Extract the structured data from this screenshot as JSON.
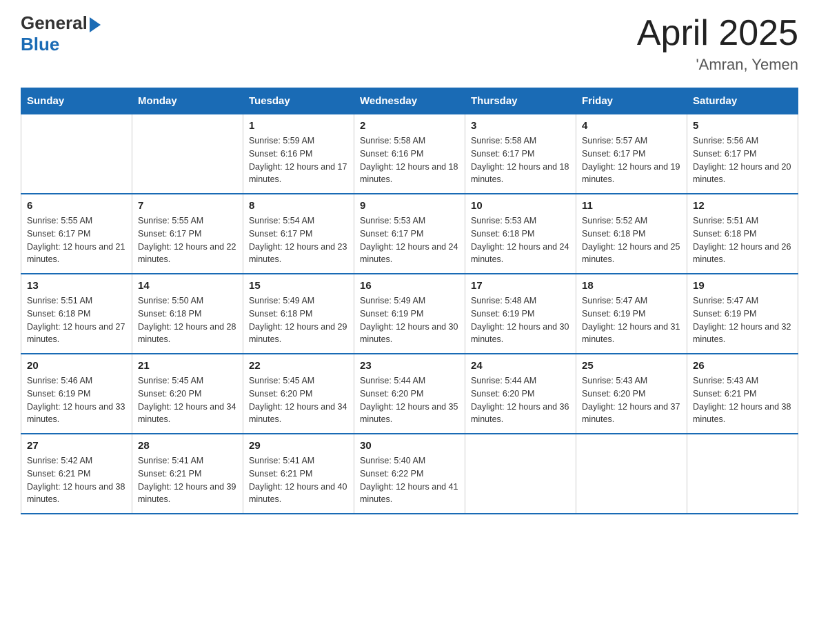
{
  "header": {
    "logo": {
      "text_general": "General",
      "text_blue": "Blue"
    },
    "month_title": "April 2025",
    "location": "'Amran, Yemen"
  },
  "weekdays": [
    "Sunday",
    "Monday",
    "Tuesday",
    "Wednesday",
    "Thursday",
    "Friday",
    "Saturday"
  ],
  "weeks": [
    [
      {
        "day": "",
        "sunrise": "",
        "sunset": "",
        "daylight": ""
      },
      {
        "day": "",
        "sunrise": "",
        "sunset": "",
        "daylight": ""
      },
      {
        "day": "1",
        "sunrise": "Sunrise: 5:59 AM",
        "sunset": "Sunset: 6:16 PM",
        "daylight": "Daylight: 12 hours and 17 minutes."
      },
      {
        "day": "2",
        "sunrise": "Sunrise: 5:58 AM",
        "sunset": "Sunset: 6:16 PM",
        "daylight": "Daylight: 12 hours and 18 minutes."
      },
      {
        "day": "3",
        "sunrise": "Sunrise: 5:58 AM",
        "sunset": "Sunset: 6:17 PM",
        "daylight": "Daylight: 12 hours and 18 minutes."
      },
      {
        "day": "4",
        "sunrise": "Sunrise: 5:57 AM",
        "sunset": "Sunset: 6:17 PM",
        "daylight": "Daylight: 12 hours and 19 minutes."
      },
      {
        "day": "5",
        "sunrise": "Sunrise: 5:56 AM",
        "sunset": "Sunset: 6:17 PM",
        "daylight": "Daylight: 12 hours and 20 minutes."
      }
    ],
    [
      {
        "day": "6",
        "sunrise": "Sunrise: 5:55 AM",
        "sunset": "Sunset: 6:17 PM",
        "daylight": "Daylight: 12 hours and 21 minutes."
      },
      {
        "day": "7",
        "sunrise": "Sunrise: 5:55 AM",
        "sunset": "Sunset: 6:17 PM",
        "daylight": "Daylight: 12 hours and 22 minutes."
      },
      {
        "day": "8",
        "sunrise": "Sunrise: 5:54 AM",
        "sunset": "Sunset: 6:17 PM",
        "daylight": "Daylight: 12 hours and 23 minutes."
      },
      {
        "day": "9",
        "sunrise": "Sunrise: 5:53 AM",
        "sunset": "Sunset: 6:17 PM",
        "daylight": "Daylight: 12 hours and 24 minutes."
      },
      {
        "day": "10",
        "sunrise": "Sunrise: 5:53 AM",
        "sunset": "Sunset: 6:18 PM",
        "daylight": "Daylight: 12 hours and 24 minutes."
      },
      {
        "day": "11",
        "sunrise": "Sunrise: 5:52 AM",
        "sunset": "Sunset: 6:18 PM",
        "daylight": "Daylight: 12 hours and 25 minutes."
      },
      {
        "day": "12",
        "sunrise": "Sunrise: 5:51 AM",
        "sunset": "Sunset: 6:18 PM",
        "daylight": "Daylight: 12 hours and 26 minutes."
      }
    ],
    [
      {
        "day": "13",
        "sunrise": "Sunrise: 5:51 AM",
        "sunset": "Sunset: 6:18 PM",
        "daylight": "Daylight: 12 hours and 27 minutes."
      },
      {
        "day": "14",
        "sunrise": "Sunrise: 5:50 AM",
        "sunset": "Sunset: 6:18 PM",
        "daylight": "Daylight: 12 hours and 28 minutes."
      },
      {
        "day": "15",
        "sunrise": "Sunrise: 5:49 AM",
        "sunset": "Sunset: 6:18 PM",
        "daylight": "Daylight: 12 hours and 29 minutes."
      },
      {
        "day": "16",
        "sunrise": "Sunrise: 5:49 AM",
        "sunset": "Sunset: 6:19 PM",
        "daylight": "Daylight: 12 hours and 30 minutes."
      },
      {
        "day": "17",
        "sunrise": "Sunrise: 5:48 AM",
        "sunset": "Sunset: 6:19 PM",
        "daylight": "Daylight: 12 hours and 30 minutes."
      },
      {
        "day": "18",
        "sunrise": "Sunrise: 5:47 AM",
        "sunset": "Sunset: 6:19 PM",
        "daylight": "Daylight: 12 hours and 31 minutes."
      },
      {
        "day": "19",
        "sunrise": "Sunrise: 5:47 AM",
        "sunset": "Sunset: 6:19 PM",
        "daylight": "Daylight: 12 hours and 32 minutes."
      }
    ],
    [
      {
        "day": "20",
        "sunrise": "Sunrise: 5:46 AM",
        "sunset": "Sunset: 6:19 PM",
        "daylight": "Daylight: 12 hours and 33 minutes."
      },
      {
        "day": "21",
        "sunrise": "Sunrise: 5:45 AM",
        "sunset": "Sunset: 6:20 PM",
        "daylight": "Daylight: 12 hours and 34 minutes."
      },
      {
        "day": "22",
        "sunrise": "Sunrise: 5:45 AM",
        "sunset": "Sunset: 6:20 PM",
        "daylight": "Daylight: 12 hours and 34 minutes."
      },
      {
        "day": "23",
        "sunrise": "Sunrise: 5:44 AM",
        "sunset": "Sunset: 6:20 PM",
        "daylight": "Daylight: 12 hours and 35 minutes."
      },
      {
        "day": "24",
        "sunrise": "Sunrise: 5:44 AM",
        "sunset": "Sunset: 6:20 PM",
        "daylight": "Daylight: 12 hours and 36 minutes."
      },
      {
        "day": "25",
        "sunrise": "Sunrise: 5:43 AM",
        "sunset": "Sunset: 6:20 PM",
        "daylight": "Daylight: 12 hours and 37 minutes."
      },
      {
        "day": "26",
        "sunrise": "Sunrise: 5:43 AM",
        "sunset": "Sunset: 6:21 PM",
        "daylight": "Daylight: 12 hours and 38 minutes."
      }
    ],
    [
      {
        "day": "27",
        "sunrise": "Sunrise: 5:42 AM",
        "sunset": "Sunset: 6:21 PM",
        "daylight": "Daylight: 12 hours and 38 minutes."
      },
      {
        "day": "28",
        "sunrise": "Sunrise: 5:41 AM",
        "sunset": "Sunset: 6:21 PM",
        "daylight": "Daylight: 12 hours and 39 minutes."
      },
      {
        "day": "29",
        "sunrise": "Sunrise: 5:41 AM",
        "sunset": "Sunset: 6:21 PM",
        "daylight": "Daylight: 12 hours and 40 minutes."
      },
      {
        "day": "30",
        "sunrise": "Sunrise: 5:40 AM",
        "sunset": "Sunset: 6:22 PM",
        "daylight": "Daylight: 12 hours and 41 minutes."
      },
      {
        "day": "",
        "sunrise": "",
        "sunset": "",
        "daylight": ""
      },
      {
        "day": "",
        "sunrise": "",
        "sunset": "",
        "daylight": ""
      },
      {
        "day": "",
        "sunrise": "",
        "sunset": "",
        "daylight": ""
      }
    ]
  ]
}
